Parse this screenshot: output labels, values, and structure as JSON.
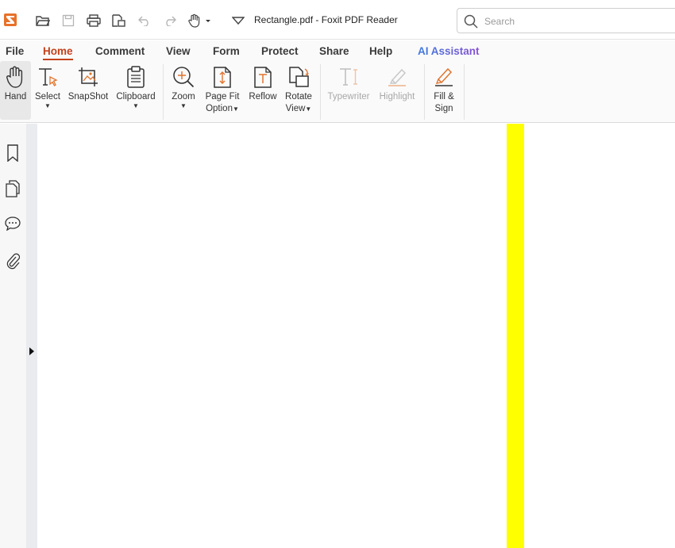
{
  "window": {
    "title": "Rectangle.pdf - Foxit PDF Reader"
  },
  "search": {
    "placeholder": "Search"
  },
  "quick_access": [
    "open-icon",
    "save-icon",
    "print-icon",
    "export-icon",
    "undo-icon",
    "redo-icon",
    "hand-tool-icon",
    "customize-icon"
  ],
  "menu": {
    "tabs": [
      {
        "label": "File"
      },
      {
        "label": "Home"
      },
      {
        "label": "Comment"
      },
      {
        "label": "View"
      },
      {
        "label": "Form"
      },
      {
        "label": "Protect"
      },
      {
        "label": "Share"
      },
      {
        "label": "Help"
      },
      {
        "label": "AI Assistant"
      }
    ],
    "active": "Home"
  },
  "ribbon": {
    "hand": "Hand",
    "select": "Select",
    "snapshot": "SnapShot",
    "clipboard": "Clipboard",
    "zoom": "Zoom",
    "page_fit_1": "Page Fit",
    "page_fit_2": "Option",
    "reflow": "Reflow",
    "rotate_1": "Rotate",
    "rotate_2": "View",
    "typewriter": "Typewriter",
    "highlight": "Highlight",
    "fill_sign_1": "Fill &",
    "fill_sign_2": "Sign"
  },
  "sidebar": [
    "bookmark-icon",
    "pages-icon",
    "comments-icon",
    "attachments-icon"
  ],
  "document": {
    "rectangle_color": "#ffff00"
  },
  "colors": {
    "accent": "#c4421a",
    "brand": "#e8712a"
  }
}
